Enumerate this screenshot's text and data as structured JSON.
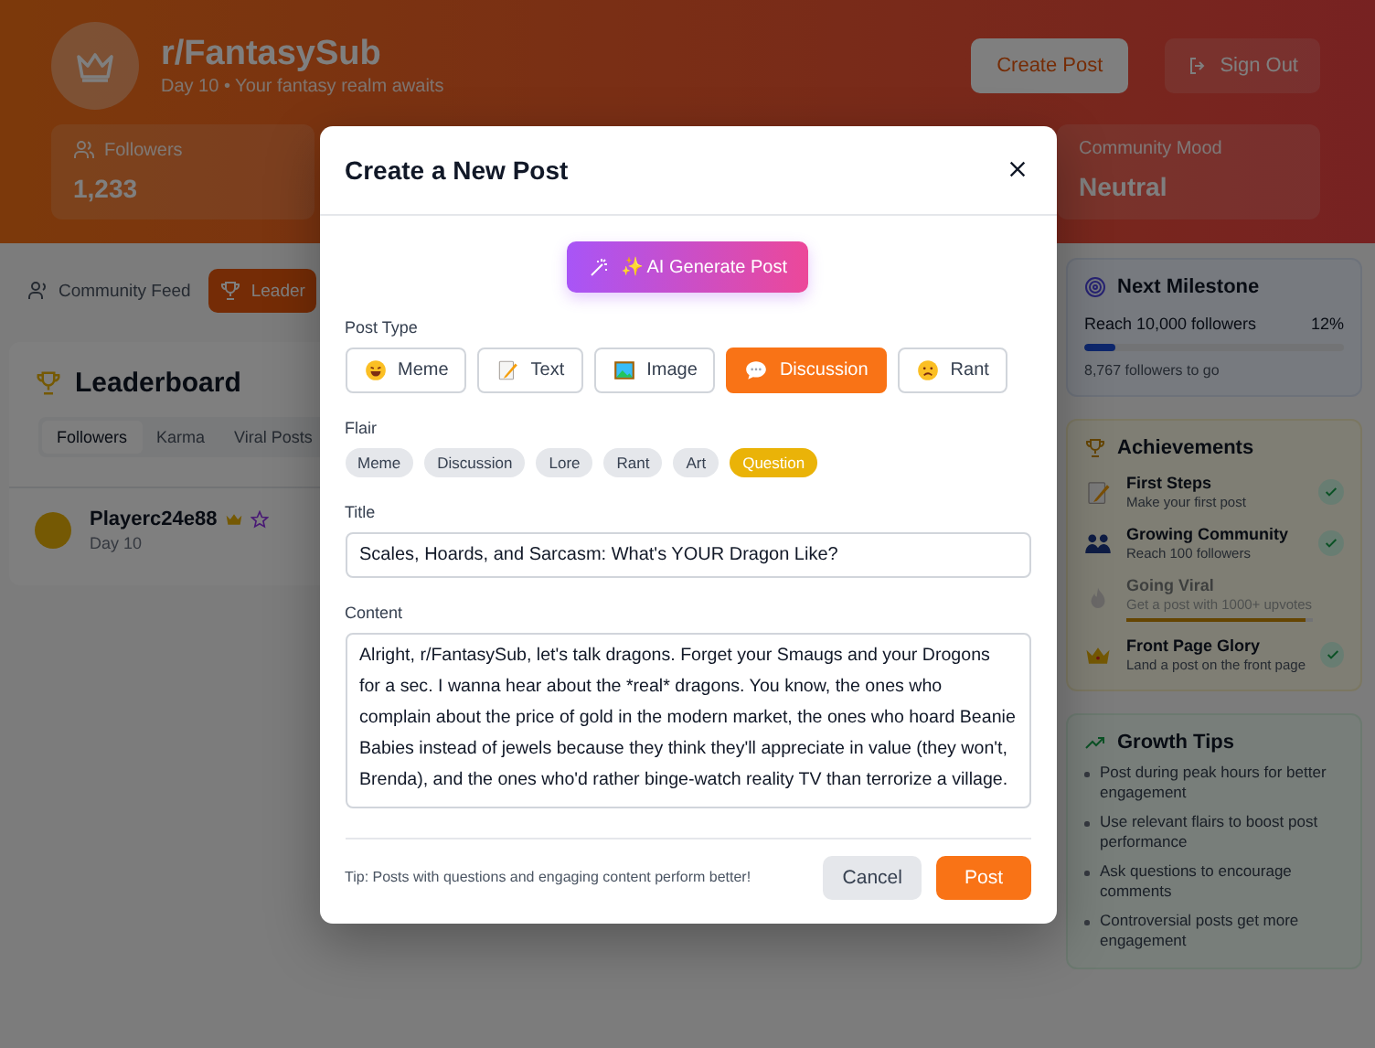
{
  "header": {
    "title": "r/FantasySub",
    "subtitle": "Day 10 • Your fantasy realm awaits",
    "buttons": [
      {
        "label": "Create Post",
        "kind": "primary"
      },
      {
        "label": "Sign Out",
        "kind": "signout"
      }
    ]
  },
  "stats": [
    {
      "label": "Followers",
      "value": "1,233",
      "kind": "followers"
    },
    {
      "label": "Community Mood",
      "value": "Neutral",
      "kind": "mood"
    }
  ],
  "tabs": [
    {
      "label": "Community Feed",
      "kind": "feed",
      "selected": false
    },
    {
      "label": "Leader",
      "kind": "trophy",
      "selected": true
    }
  ],
  "leaderboard": {
    "title": "Leaderboard",
    "tabs": [
      {
        "label": "Followers",
        "selected": true
      },
      {
        "label": "Karma",
        "selected": false
      },
      {
        "label": "Viral Posts",
        "selected": false
      }
    ],
    "rows": [
      {
        "name": "Playerc24e88",
        "detail": "Day 10"
      }
    ]
  },
  "sidebar": {
    "milestone": {
      "title": "Next Milestone",
      "label": "Reach 10,000 followers",
      "percent": "12%",
      "level": 0.12,
      "note": "8,767 followers to go"
    },
    "achievements": {
      "title": "Achievements",
      "items": [
        {
          "title": "First Steps",
          "description": "Make your first post",
          "kind": "memo",
          "unlocked": true
        },
        {
          "title": "Growing Community",
          "description": "Reach 100 followers",
          "kind": "people",
          "unlocked": true
        },
        {
          "title": "Going Viral",
          "description": "Get a post with 1000+ upvotes",
          "kind": "fire",
          "unlocked": false,
          "level": 0.97
        },
        {
          "title": "Front Page Glory",
          "description": "Land a post on the front page",
          "kind": "crown",
          "unlocked": true
        }
      ]
    },
    "tips": {
      "title": "Growth Tips",
      "items": [
        "Post during peak hours for better engagement",
        "Use relevant flairs to boost post performance",
        "Ask questions to encourage comments",
        "Controversial posts get more engagement"
      ]
    }
  },
  "modal": {
    "title": "Create a New Post",
    "ai_button": "✨ AI Generate Post",
    "post_type_label": "Post Type",
    "post_types": [
      {
        "label": "Meme",
        "kind": "laugh",
        "selected": false
      },
      {
        "label": "Text",
        "kind": "memo",
        "selected": false
      },
      {
        "label": "Image",
        "kind": "image",
        "selected": false
      },
      {
        "label": "Discussion",
        "kind": "speech",
        "selected": true
      },
      {
        "label": "Rant",
        "kind": "angry",
        "selected": false
      }
    ],
    "flair_label": "Flair",
    "flairs": [
      {
        "label": "Meme",
        "selected": false
      },
      {
        "label": "Discussion",
        "selected": false
      },
      {
        "label": "Lore",
        "selected": false
      },
      {
        "label": "Rant",
        "selected": false
      },
      {
        "label": "Art",
        "selected": false
      },
      {
        "label": "Question",
        "selected": true
      }
    ],
    "title_label": "Title",
    "title_value": "Scales, Hoards, and Sarcasm: What's YOUR Dragon Like?",
    "content_label": "Content",
    "content_value": "Alright, r/FantasySub, let's talk dragons. Forget your Smaugs and your Drogons for a sec. I wanna hear about the *real* dragons. You know, the ones who complain about the price of gold in the modern market, the ones who hoard Beanie Babies instead of jewels because they think they'll appreciate in value (they won't, Brenda), and the ones who'd rather binge-watch reality TV than terrorize a village.",
    "tip": "Tip: Posts with questions and engaging content perform better!",
    "buttons": [
      {
        "label": "Cancel",
        "kind": "cancel"
      },
      {
        "label": "Post",
        "kind": "submit"
      }
    ]
  }
}
